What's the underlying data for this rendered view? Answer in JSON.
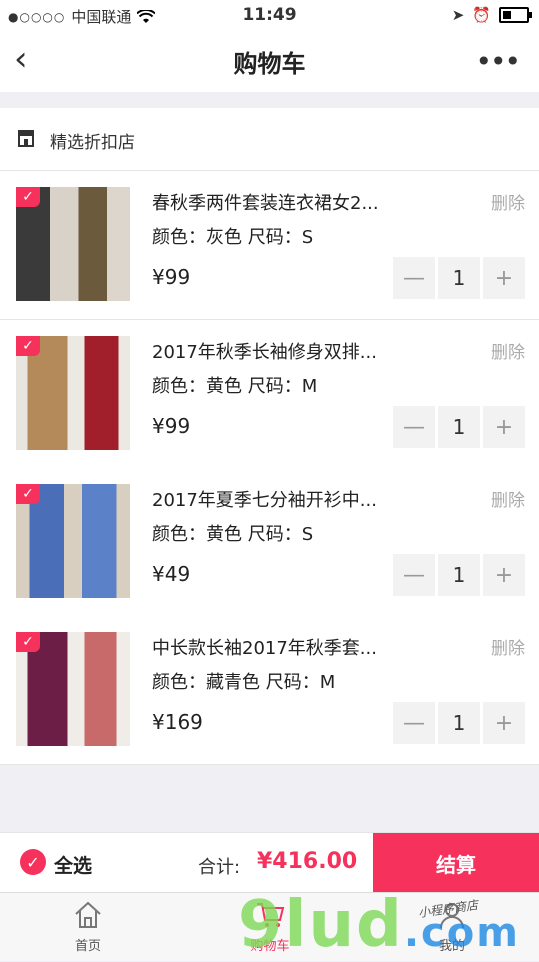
{
  "status": {
    "carrier": "中国联通",
    "time": "11:49"
  },
  "nav": {
    "title": "购物车"
  },
  "shop": {
    "name": "精选折扣店"
  },
  "items": [
    {
      "name": "春秋季两件套装连衣裙女2...",
      "attr": "颜色：灰色 尺码：S",
      "price": "¥99",
      "delete": "删除",
      "qty": "1",
      "colors": [
        "#2e2e2e",
        "#6b5a3c"
      ]
    },
    {
      "name": "2017年秋季长袖修身双排...",
      "attr": "颜色：黄色 尺码：M",
      "price": "¥99",
      "delete": "删除",
      "qty": "1",
      "colors": [
        "#b58a5a",
        "#a01f2a"
      ]
    },
    {
      "name": "2017年夏季七分袖开衫中...",
      "attr": "颜色：黄色 尺码：S",
      "price": "¥49",
      "delete": "删除",
      "qty": "1",
      "colors": [
        "#4a6fb8",
        "#5b82c9"
      ]
    },
    {
      "name": "中长款长袖2017年秋季套...",
      "attr": "颜色：藏青色 尺码：M",
      "price": "¥169",
      "delete": "删除",
      "qty": "1",
      "colors": [
        "#6d1e47",
        "#c96a6a"
      ]
    }
  ],
  "footer": {
    "select_all": "全选",
    "total_label": "合计:",
    "total_value": "¥416.00",
    "checkout": "结算"
  },
  "tabs": [
    {
      "label": "首页",
      "active": false
    },
    {
      "label": "购物车",
      "active": true
    },
    {
      "label": "我的",
      "active": false
    }
  ],
  "watermark": {
    "logo": "9lud",
    "domain": ".com",
    "text": "小程序商店"
  },
  "theme": {
    "accent": "#f5315c"
  }
}
